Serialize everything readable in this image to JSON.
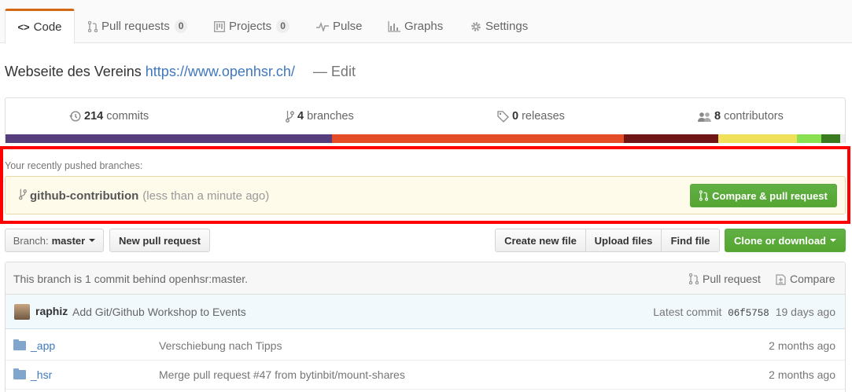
{
  "tabs": [
    {
      "icon": "code-icon",
      "glyph": "<>",
      "label": "Code",
      "selected": true
    },
    {
      "icon": "pull-request-icon",
      "label": "Pull requests",
      "count": "0"
    },
    {
      "icon": "project-icon",
      "label": "Projects",
      "count": "0"
    },
    {
      "icon": "pulse-icon",
      "label": "Pulse"
    },
    {
      "icon": "graph-icon",
      "label": "Graphs"
    },
    {
      "icon": "gear-icon",
      "label": "Settings"
    }
  ],
  "repo": {
    "description": "Webseite des Vereins",
    "website": "https://www.openhsr.ch/",
    "edit_label": "— Edit"
  },
  "summary": {
    "commits": {
      "count": "214",
      "label": "commits"
    },
    "branches": {
      "count": "4",
      "label": "branches"
    },
    "releases": {
      "count": "0",
      "label": "releases"
    },
    "contributors": {
      "count": "8",
      "label": "contributors"
    }
  },
  "language_colors": [
    "#563d7c",
    "#e34c26",
    "#701516",
    "#f1e05a",
    "#89e051",
    "#3a7b1f",
    "#ededed"
  ],
  "language_shares": [
    0.389,
    0.348,
    0.112,
    0.094,
    0.029,
    0.022,
    0.006
  ],
  "recent": {
    "label": "Your recently pushed branches:",
    "branch": "github-contribution",
    "ago": "(less than a minute ago)",
    "compare_button": "Compare & pull request"
  },
  "file_nav": {
    "branch_prefix": "Branch:",
    "branch_name": "master",
    "new_pr": "New pull request",
    "create_file": "Create new file",
    "upload_files": "Upload files",
    "find_file": "Find file",
    "clone": "Clone or download"
  },
  "behind": {
    "message": "This branch is 1 commit behind openhsr:master.",
    "pull_request": "Pull request",
    "compare": "Compare"
  },
  "latest_commit": {
    "author": "raphiz",
    "message": "Add Git/Github Workshop to Events",
    "prefix": "Latest commit",
    "sha": "06f5758",
    "age": "19 days ago"
  },
  "files": [
    {
      "name": "_app",
      "message": "Verschiebung nach Tipps",
      "age": "2 months ago"
    },
    {
      "name": "_hsr",
      "message": "Merge pull request #47 from bytinbit/mount-shares",
      "age": "2 months ago"
    }
  ],
  "colors": {
    "accent": "#d26911",
    "link": "#4078c0",
    "green": "#55a532",
    "highlight": "#ff0000"
  }
}
